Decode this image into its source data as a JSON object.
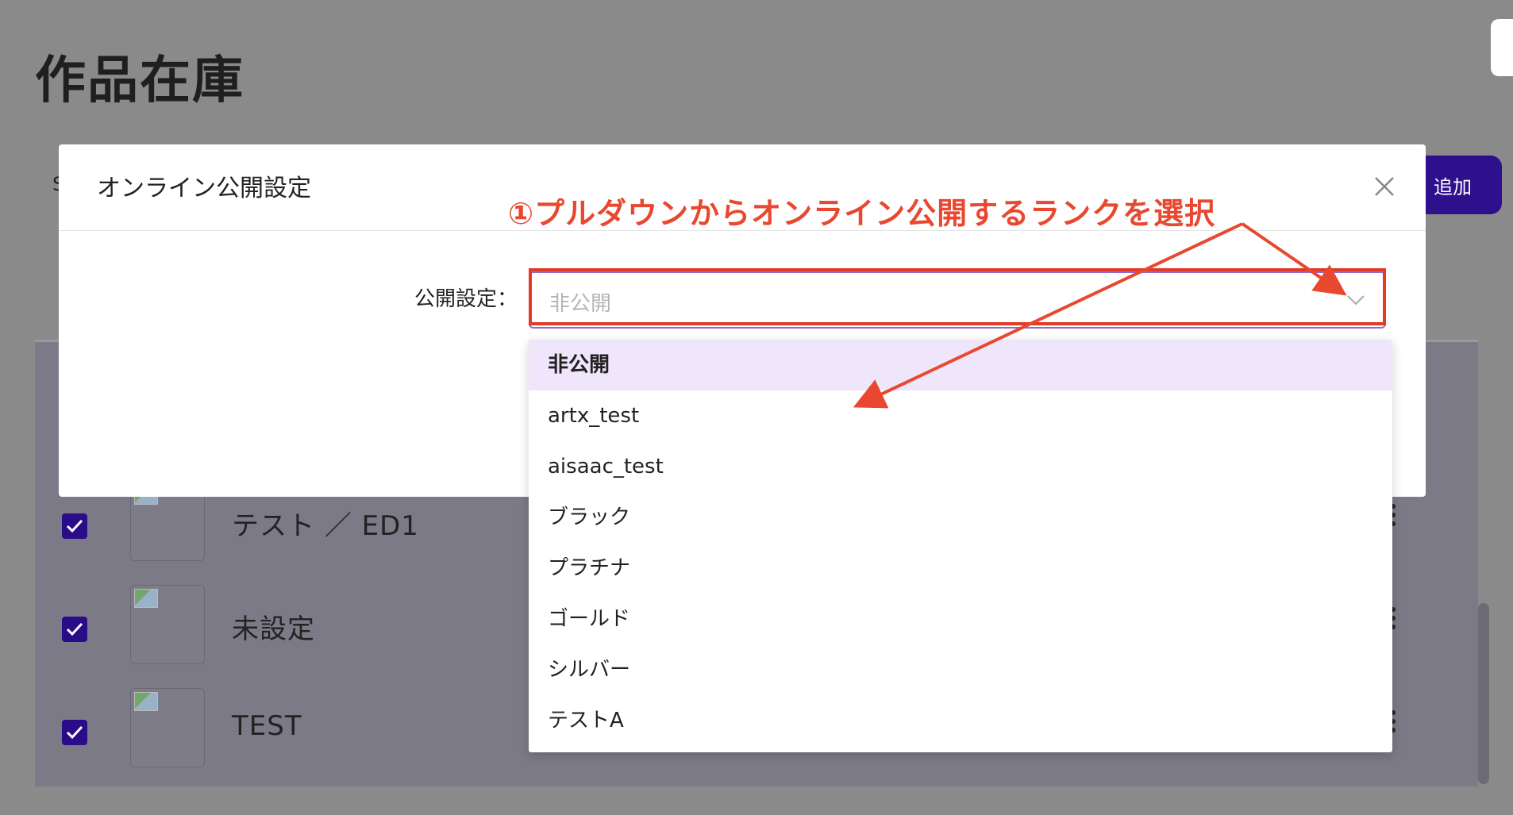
{
  "page": {
    "title": "作品在庫",
    "partial_letter": "S",
    "add_button_label": "追加"
  },
  "table": {
    "rows": [
      {
        "name": "テスト ／ ED1",
        "checked": true
      },
      {
        "name": "未設定",
        "checked": true
      },
      {
        "name": "TEST",
        "checked": true
      }
    ]
  },
  "modal": {
    "title": "オンライン公開設定",
    "field_label": "公開設定：",
    "select_value": "非公開"
  },
  "dropdown": {
    "options": [
      "非公開",
      "artx_test",
      "aisaac_test",
      "ブラック",
      "プラチナ",
      "ゴールド",
      "シルバー",
      "テストA"
    ],
    "selected_index": 0
  },
  "annotation": {
    "text": "①プルダウンからオンライン公開するランクを選択"
  },
  "colors": {
    "accent": "#2e0f8c",
    "annotation": "#e8482f",
    "selected_bg": "#f0e6fc"
  }
}
